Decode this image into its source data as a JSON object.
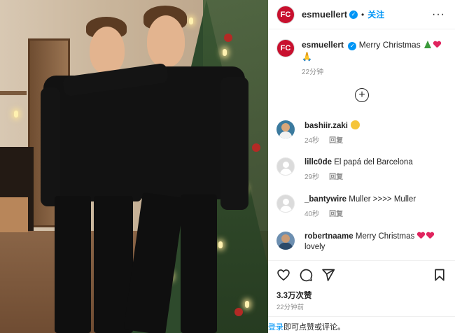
{
  "post": {
    "username": "esmuellert",
    "follow_label": "关注",
    "more_label": "···",
    "avatar_initial": "FC",
    "caption_text": "Merry Christmas",
    "caption_time": "22分钟",
    "add_comment_label": "+"
  },
  "comments": [
    {
      "username": "bashiir.zaki",
      "text": "",
      "time": "24秒",
      "reply": "回复"
    },
    {
      "username": "lillc0de",
      "text": "El papá del Barcelona",
      "time": "29秒",
      "reply": "回复"
    },
    {
      "username": "_bantywire",
      "text": "Muller >>>> Muller",
      "time": "40秒",
      "reply": "回复"
    },
    {
      "username": "robertnaame",
      "text": "Merry Christmas",
      "text2": "lovely",
      "time": "",
      "reply": ""
    }
  ],
  "stats": {
    "likes": "3.3万次赞",
    "time": "22分钟前"
  },
  "login": {
    "link": "登录",
    "text": "即可点赞或评论。"
  },
  "icons": {
    "like": "heart-icon",
    "comment": "comment-icon",
    "share": "paper-plane-icon",
    "save": "bookmark-icon"
  },
  "colors": {
    "accent": "#0095f6",
    "text": "#262626",
    "muted": "#8e8e8e",
    "heart": "#e0245e"
  }
}
